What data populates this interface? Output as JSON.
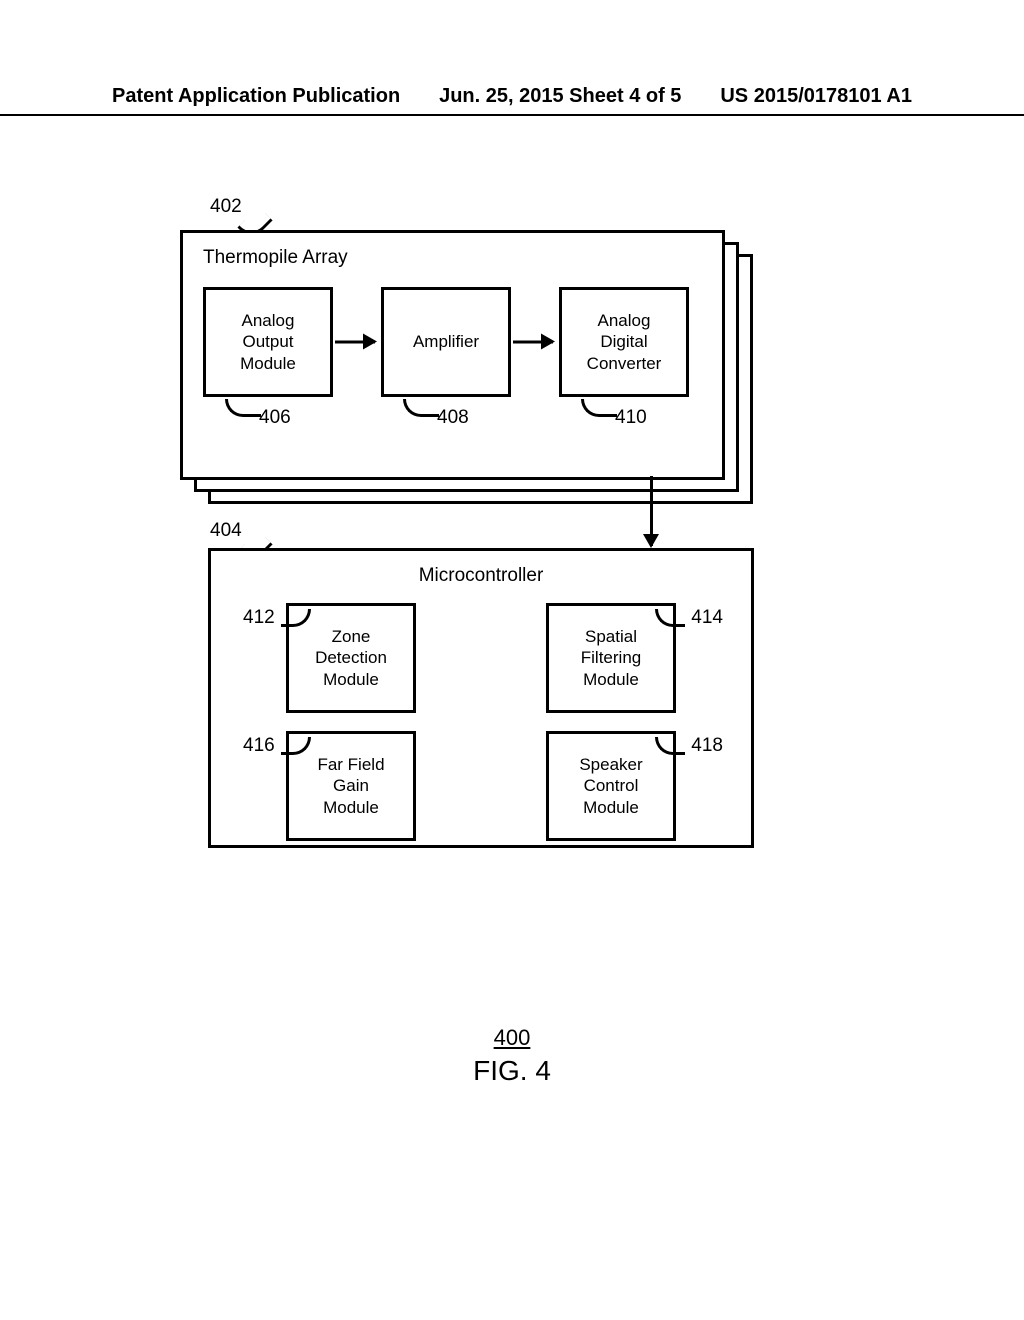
{
  "header": {
    "left": "Patent Application Publication",
    "center": "Jun. 25, 2015  Sheet 4 of 5",
    "right": "US 2015/0178101 A1"
  },
  "thermopile": {
    "title": "Thermopile Array",
    "ref": "402",
    "boxes": {
      "analog_out": {
        "label": "Analog\nOutput\nModule",
        "ref": "406"
      },
      "amplifier": {
        "label": "Amplifier",
        "ref": "408"
      },
      "adc": {
        "label": "Analog\nDigital\nConverter",
        "ref": "410"
      }
    }
  },
  "microcontroller": {
    "title": "Microcontroller",
    "ref": "404",
    "boxes": {
      "zone": {
        "label": "Zone\nDetection\nModule",
        "ref": "412"
      },
      "spatial": {
        "label": "Spatial\nFiltering\nModule",
        "ref": "414"
      },
      "farfield": {
        "label": "Far Field\nGain\nModule",
        "ref": "416"
      },
      "speaker": {
        "label": "Speaker\nControl\nModule",
        "ref": "418"
      }
    }
  },
  "figure": {
    "number": "400",
    "label": "FIG. 4"
  },
  "chart_data": {
    "type": "diagram",
    "nodes": [
      {
        "id": "402",
        "label": "Thermopile Array",
        "children": [
          "406",
          "408",
          "410"
        ]
      },
      {
        "id": "406",
        "label": "Analog Output Module"
      },
      {
        "id": "408",
        "label": "Amplifier"
      },
      {
        "id": "410",
        "label": "Analog Digital Converter"
      },
      {
        "id": "404",
        "label": "Microcontroller",
        "children": [
          "412",
          "414",
          "416",
          "418"
        ]
      },
      {
        "id": "412",
        "label": "Zone Detection Module"
      },
      {
        "id": "414",
        "label": "Spatial Filtering Module"
      },
      {
        "id": "416",
        "label": "Far Field Gain Module"
      },
      {
        "id": "418",
        "label": "Speaker Control Module"
      }
    ],
    "edges": [
      {
        "from": "406",
        "to": "408"
      },
      {
        "from": "408",
        "to": "410"
      },
      {
        "from": "402",
        "to": "404"
      }
    ],
    "figure_ref": "400"
  }
}
